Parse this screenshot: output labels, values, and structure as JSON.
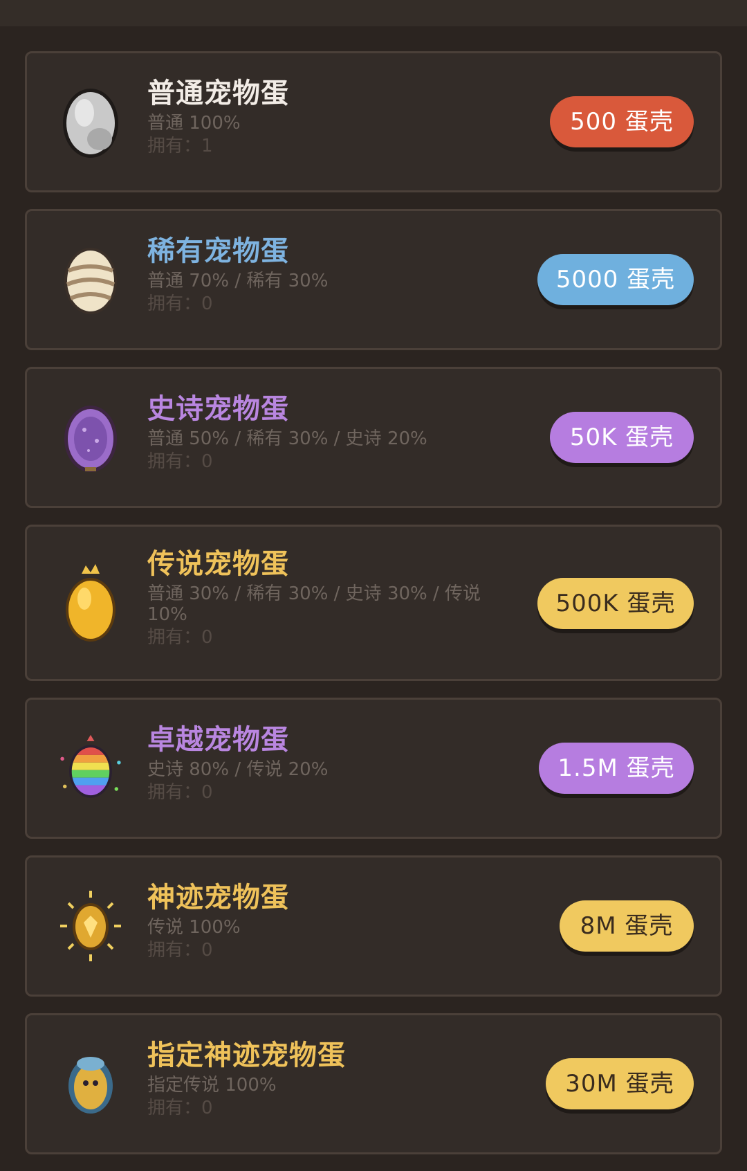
{
  "eggs": [
    {
      "name": "普通宠物蛋",
      "odds": "普通 100%",
      "owned": "拥有：1",
      "price": "500 蛋壳",
      "name_color": "#f2ece6",
      "btn_color": "#d9593b",
      "icon": "gray-egg-icon"
    },
    {
      "name": "稀有宠物蛋",
      "odds": "普通 70% / 稀有 30%",
      "owned": "拥有：0",
      "price": "5000 蛋壳",
      "name_color": "#7eb3e0",
      "btn_color": "#6fb0de",
      "icon": "striped-egg-icon"
    },
    {
      "name": "史诗宠物蛋",
      "odds": "普通 50% / 稀有 30% / 史诗 20%",
      "owned": "拥有：0",
      "price": "50K 蛋壳",
      "name_color": "#b986e0",
      "btn_color": "#b67de0",
      "icon": "purple-egg-icon"
    },
    {
      "name": "传说宠物蛋",
      "odds": "普通 30% / 稀有 30% / 史诗 30% / 传说 10%",
      "owned": "拥有：0",
      "price": "500K 蛋壳",
      "name_color": "#efc25a",
      "btn_color": "#f0c95f",
      "icon": "golden-crown-egg-icon"
    },
    {
      "name": "卓越宠物蛋",
      "odds": "史诗 80% / 传说 20%",
      "owned": "拥有：0",
      "price": "1.5M 蛋壳",
      "name_color": "#b986e0",
      "btn_color": "#b67de0",
      "icon": "rainbow-egg-icon"
    },
    {
      "name": "神迹宠物蛋",
      "odds": "传说 100%",
      "owned": "拥有：0",
      "price": "8M 蛋壳",
      "name_color": "#efc25a",
      "btn_color": "#f0c95f",
      "icon": "radiant-egg-icon"
    },
    {
      "name": "指定神迹宠物蛋",
      "odds": "指定传说 100%",
      "owned": "拥有：0",
      "price": "30M 蛋壳",
      "name_color": "#efc25a",
      "btn_color": "#f0c95f",
      "icon": "hooded-egg-icon"
    }
  ]
}
